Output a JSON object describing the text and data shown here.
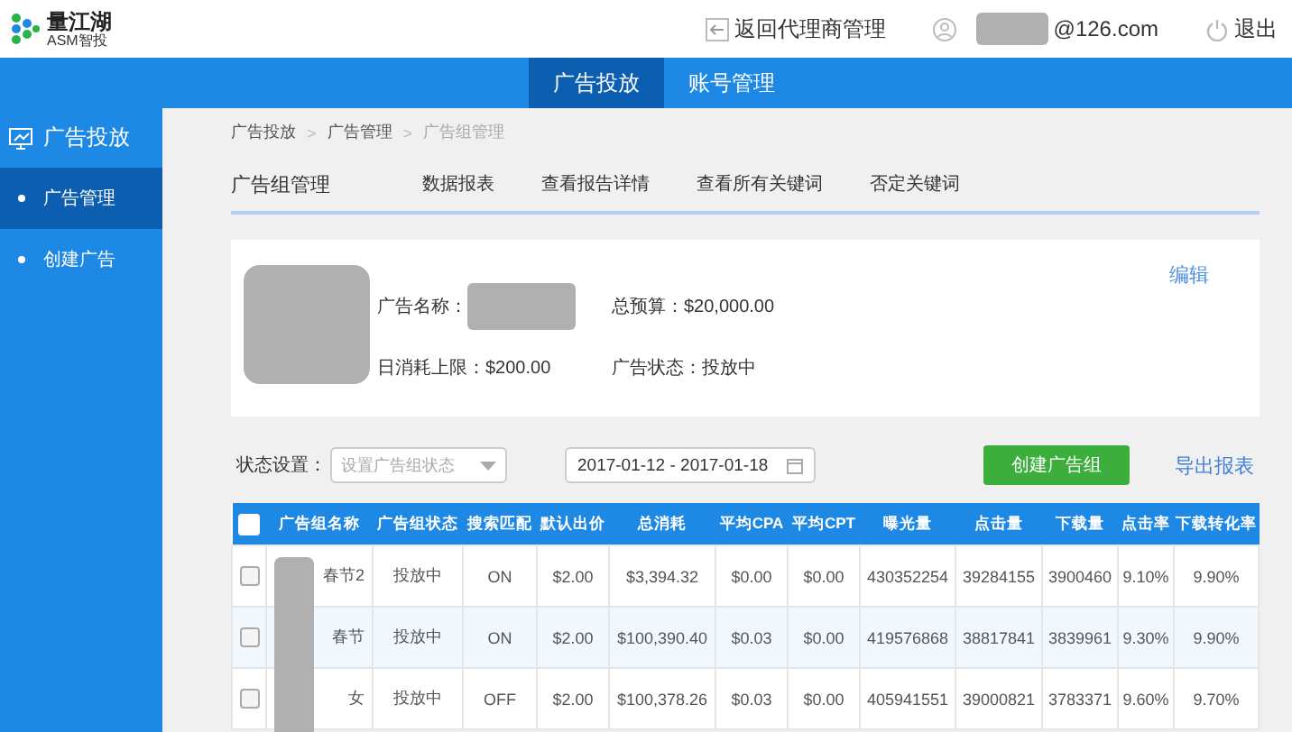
{
  "logo": {
    "name": "量江湖",
    "subtitle": "ASM智投"
  },
  "header_links": [
    {
      "kind": "back",
      "label": "返回代理商管理"
    },
    {
      "kind": "user",
      "label": "@126.com"
    },
    {
      "kind": "logout",
      "label": "退出"
    }
  ],
  "nav_tabs": [
    {
      "label": "广告投放",
      "selected": true
    },
    {
      "label": "账号管理",
      "selected": false
    }
  ],
  "sidebar": {
    "title": "广告投放",
    "items": [
      {
        "label": "广告管理",
        "selected": true
      },
      {
        "label": "创建广告",
        "selected": false
      }
    ]
  },
  "breadcrumb": [
    {
      "label": "广告投放",
      "current": false
    },
    {
      "label": "广告管理",
      "current": false
    },
    {
      "label": "广告组管理",
      "current": true
    }
  ],
  "breadcrumb_separator": ">",
  "page_title": "广告组管理",
  "sub_tabs": [
    "数据报表",
    "查看报告详情",
    "查看所有关键词",
    "否定关键词"
  ],
  "ad_card": {
    "edit": "编辑",
    "fields": [
      {
        "label": "广告名称："
      },
      {
        "label": "总预算：",
        "value": "$20,000.00"
      },
      {
        "label": "日消耗上限：",
        "value": "$200.00"
      },
      {
        "label": "广告状态：",
        "value": "投放中"
      }
    ]
  },
  "filters": {
    "status_label": "状态设置：",
    "status_select": {
      "placeholder": "设置广告组状态"
    },
    "date_range": "2017-01-12 - 2017-01-18",
    "create_button": "创建广告组",
    "export_link": "导出报表"
  },
  "table": {
    "select_all": {
      "checked": false
    },
    "columns": [
      "广告组名称",
      "广告组状态",
      "搜索匹配",
      "默认出价",
      "总消耗",
      "平均CPA",
      "平均CPT",
      "曝光量",
      "点击量",
      "下载量",
      "点击率",
      "下载转化率"
    ],
    "rows": [
      {
        "checked": false,
        "cells": [
          "春节2",
          "投放中",
          "ON",
          "$2.00",
          "$3,394.32",
          "$0.00",
          "$0.00",
          "430352254",
          "39284155",
          "3900460",
          "9.10%",
          "9.90%"
        ]
      },
      {
        "checked": false,
        "cells": [
          "春节",
          "投放中",
          "ON",
          "$2.00",
          "$100,390.40",
          "$0.03",
          "$0.00",
          "419576868",
          "38817841",
          "3839961",
          "9.30%",
          "9.90%"
        ]
      },
      {
        "checked": false,
        "cells": [
          "女",
          "投放中",
          "OFF",
          "$2.00",
          "$100,378.26",
          "$0.03",
          "$0.00",
          "405941551",
          "39000821",
          "3783371",
          "9.60%",
          "9.70%"
        ]
      }
    ]
  }
}
